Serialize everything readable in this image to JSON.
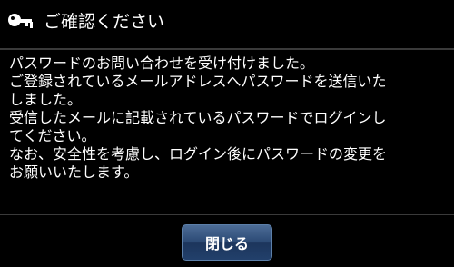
{
  "dialog": {
    "icon": "key-icon",
    "title": "ご確認ください",
    "message_lines": [
      "パスワードのお問い合わせを受け付けました。",
      "ご登録されているメールアドレスへパスワードを送信いた",
      "しました。",
      "受信したメールに記載されているパスワードでログインし",
      "てください。",
      "なお、安全性を考慮し、ログイン後にパスワードの変更を",
      "お願いいたします。"
    ],
    "close_label": "閉じる"
  },
  "colors": {
    "background": "#000000",
    "text": "#ffffff",
    "divider": "#3a3a3a",
    "button": "#2c4a75"
  }
}
